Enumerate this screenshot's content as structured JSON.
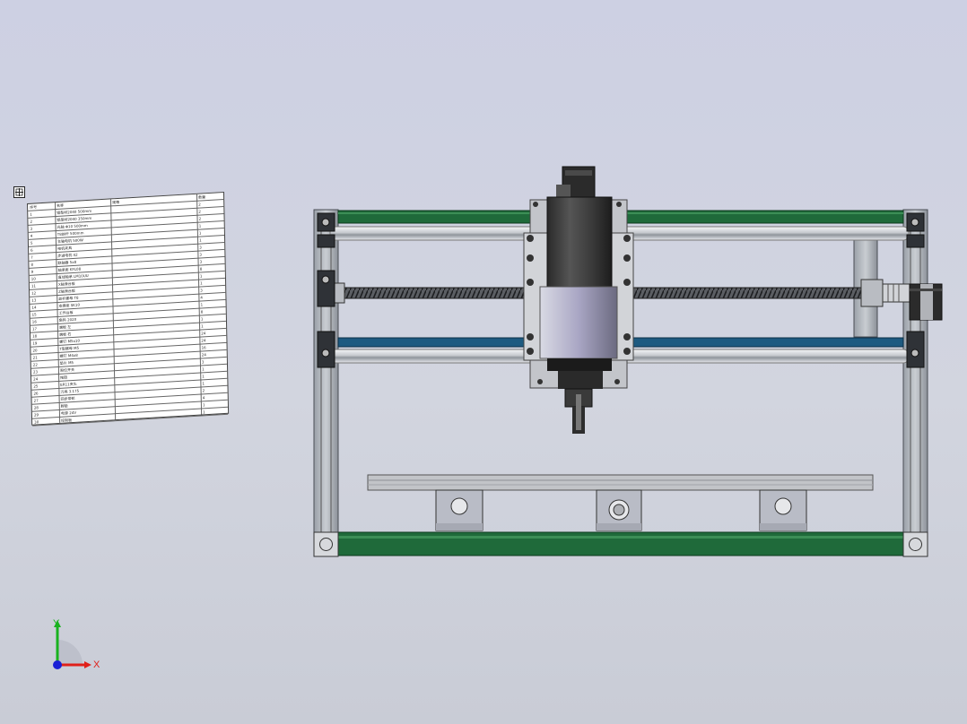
{
  "viewport": {
    "background_top": "#cdd0e3",
    "background_bottom": "#c9ccd6"
  },
  "bom_table": {
    "header": [
      "序号",
      "名称",
      "规格",
      "数量"
    ],
    "rows": [
      {
        "no": "1",
        "name": "铝型材2040 500mm",
        "spec": "",
        "qty": "2"
      },
      {
        "no": "2",
        "name": "铝型材2040 350mm",
        "spec": "",
        "qty": "2"
      },
      {
        "no": "3",
        "name": "光轴 Φ10 500mm",
        "spec": "",
        "qty": "2"
      },
      {
        "no": "4",
        "name": "T8丝杆 500mm",
        "spec": "",
        "qty": "1"
      },
      {
        "no": "5",
        "name": "主轴电机 500W",
        "spec": "",
        "qty": "1"
      },
      {
        "no": "6",
        "name": "电机夹具",
        "spec": "",
        "qty": "1"
      },
      {
        "no": "7",
        "name": "步进电机 42",
        "spec": "",
        "qty": "3"
      },
      {
        "no": "8",
        "name": "联轴器 5x8",
        "spec": "",
        "qty": "3"
      },
      {
        "no": "9",
        "name": "轴承座 KFL08",
        "spec": "",
        "qty": "3"
      },
      {
        "no": "10",
        "name": "直线轴承 LM10UU",
        "spec": "",
        "qty": "8"
      },
      {
        "no": "11",
        "name": "X轴滑台板",
        "spec": "",
        "qty": "1"
      },
      {
        "no": "12",
        "name": "Z轴滑台板",
        "spec": "",
        "qty": "1"
      },
      {
        "no": "13",
        "name": "丝杆螺母 T8",
        "spec": "",
        "qty": "3"
      },
      {
        "no": "14",
        "name": "支撑座 SK10",
        "spec": "",
        "qty": "4"
      },
      {
        "no": "15",
        "name": "工作台板",
        "spec": "",
        "qty": "1"
      },
      {
        "no": "16",
        "name": "角码 2020",
        "spec": "",
        "qty": "8"
      },
      {
        "no": "17",
        "name": "端板 左",
        "spec": "",
        "qty": "1"
      },
      {
        "no": "18",
        "name": "端板 右",
        "spec": "",
        "qty": "1"
      },
      {
        "no": "19",
        "name": "螺钉 M5x10",
        "spec": "",
        "qty": "24"
      },
      {
        "no": "20",
        "name": "T型螺母 M5",
        "spec": "",
        "qty": "24"
      },
      {
        "no": "21",
        "name": "螺钉 M4x8",
        "spec": "",
        "qty": "16"
      },
      {
        "no": "22",
        "name": "垫片 M5",
        "spec": "",
        "qty": "24"
      },
      {
        "no": "23",
        "name": "限位开关",
        "spec": "",
        "qty": "3"
      },
      {
        "no": "24",
        "name": "拖链",
        "spec": "",
        "qty": "1"
      },
      {
        "no": "25",
        "name": "ER11夹头",
        "spec": "",
        "qty": "1"
      },
      {
        "no": "26",
        "name": "刀具 3.175",
        "spec": "",
        "qty": "1"
      },
      {
        "no": "27",
        "name": "同步带轮",
        "spec": "",
        "qty": "2"
      },
      {
        "no": "28",
        "name": "脚垫",
        "spec": "",
        "qty": "4"
      },
      {
        "no": "29",
        "name": "电源 24V",
        "spec": "",
        "qty": "1"
      },
      {
        "no": "30",
        "name": "控制板",
        "spec": "",
        "qty": "1"
      }
    ]
  },
  "triad": {
    "x_label": "X",
    "y_label": "Y",
    "x_color": "#e0201a",
    "y_color": "#19b21f",
    "z_color": "#1a1fd6"
  },
  "colors": {
    "frame_green": "#1f6a3a",
    "frame_blue": "#1d5a80",
    "aluminum": "#b8bcc2",
    "dark": "#2b2b2b"
  }
}
